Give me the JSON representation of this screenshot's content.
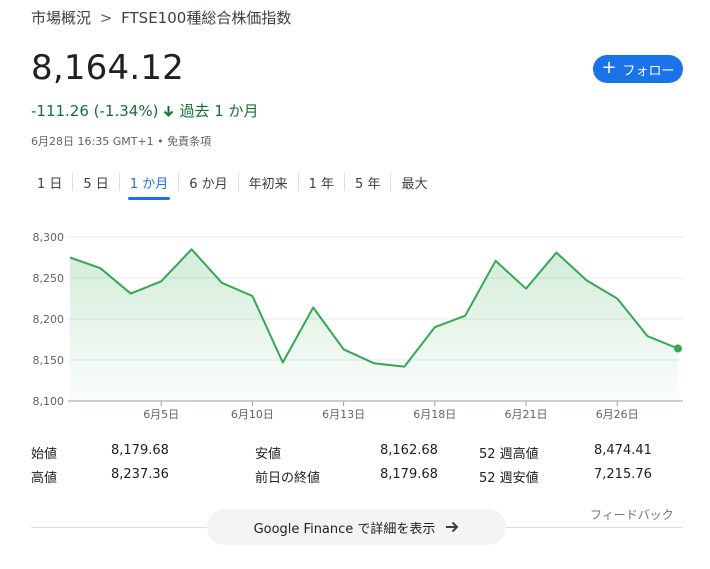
{
  "breadcrumb": {
    "parent": "市場概況",
    "separator": ">",
    "current": "FTSE100種総合株価指数"
  },
  "price": "8,164.12",
  "follow_button": {
    "label": "フォロー",
    "icon": "plus-icon"
  },
  "change": {
    "value": "-111.26 (-1.34%)",
    "direction_icon": "arrow-down-icon",
    "period": "過去 1 か月"
  },
  "timestamp": "6月28日 16:35 GMT+1 • 免責条項",
  "range_tabs": [
    {
      "label": "1 日"
    },
    {
      "label": "5 日"
    },
    {
      "label": "1 か月",
      "active": true
    },
    {
      "label": "6 か月"
    },
    {
      "label": "年初来"
    },
    {
      "label": "1 年"
    },
    {
      "label": "5 年"
    },
    {
      "label": "最大"
    }
  ],
  "colors": {
    "line": "#34a853",
    "accent": "#1a73e8",
    "positive_text": "#137333"
  },
  "chart_data": {
    "type": "area",
    "title": "",
    "xlabel": "",
    "ylabel": "",
    "ylim": [
      8100,
      8300
    ],
    "yticks": [
      "8,300",
      "8,250",
      "8,200",
      "8,150",
      "8,100"
    ],
    "ytick_values": [
      8300,
      8250,
      8200,
      8150,
      8100
    ],
    "xticks": [
      "6月5日",
      "6月10日",
      "6月13日",
      "6月18日",
      "6月21日",
      "6月26日"
    ],
    "xtick_indices": [
      3,
      6,
      9,
      12,
      15,
      18
    ],
    "grid": true,
    "series": [
      {
        "values": [
          8275,
          8262,
          8231,
          8246,
          8285,
          8244,
          8228,
          8147,
          8214,
          8163,
          8146,
          8142,
          8190,
          8204,
          8271,
          8237,
          8281,
          8247,
          8225,
          8179,
          8164
        ]
      }
    ]
  },
  "stats": [
    [
      {
        "label": "始値",
        "value": "8,179.68"
      },
      {
        "label": "安値",
        "value": "8,162.68"
      },
      {
        "label": "52 週高値",
        "value": "8,474.41"
      }
    ],
    [
      {
        "label": "高値",
        "value": "8,237.36"
      },
      {
        "label": "前日の終値",
        "value": "8,179.68"
      },
      {
        "label": "52 週安値",
        "value": "7,215.76"
      }
    ]
  ],
  "feedback": "フィードバック",
  "google_finance_button": {
    "label": "Google Finance で詳細を表示",
    "icon": "arrow-right-icon"
  }
}
